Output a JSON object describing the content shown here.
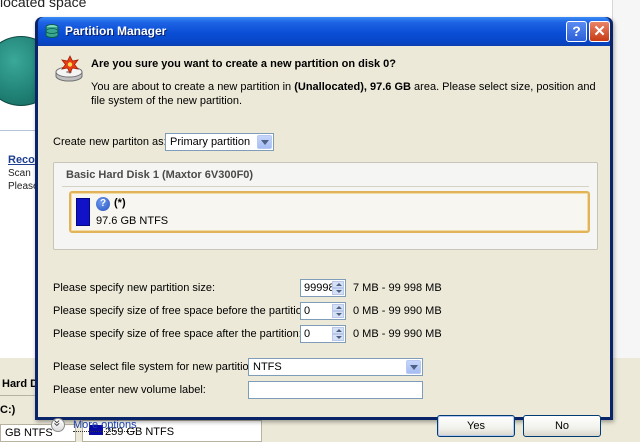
{
  "background": {
    "top_text": "located space",
    "reco_link": "Reco",
    "scan_text": "Scan",
    "please_text": "Please",
    "hard_disk_label": "Hard Di",
    "c_label": "C:)",
    "partition1_label": "GB NTFS",
    "partition2_label": "259 GB NTFS"
  },
  "dialog": {
    "title": "Partition Manager",
    "help_button": "?",
    "close_button": "✕",
    "question": "Are you sure you want to create a new partition on disk 0?",
    "desc_before": "You are about to create a new partition in ",
    "desc_bold": "(Unallocated), 97.6 GB",
    "desc_after": " area. Please select size, position and file system of the new partition.",
    "create_as_label": "Create new partiton as:",
    "create_as_value": "Primary partition",
    "disk": {
      "title": "Basic Hard Disk 1 (Maxtor 6V300F0)",
      "partition_name": "(*)",
      "partition_size": "97.6 GB NTFS"
    },
    "size_label": "Please specify new partition size:",
    "size_value": "99998",
    "size_range": "7 MB - 99 998 MB",
    "before_label": "Please specify size of free space before the partition:",
    "before_value": "0",
    "before_range": "0 MB - 99 990 MB",
    "after_label": "Please specify size of free space after the partition:",
    "after_value": "0",
    "after_range": "0 MB - 99 990 MB",
    "fs_label": "Please select file system for new partition:",
    "fs_value": "NTFS",
    "volume_label": "Please enter new volume label:",
    "volume_value": "",
    "more_options": "More options",
    "yes_button": "Yes",
    "no_button": "No"
  },
  "colors": {
    "titlebar": "#0a4ed6",
    "partition_block": "#1111c8",
    "partition_highlight": "#e2b45a"
  }
}
